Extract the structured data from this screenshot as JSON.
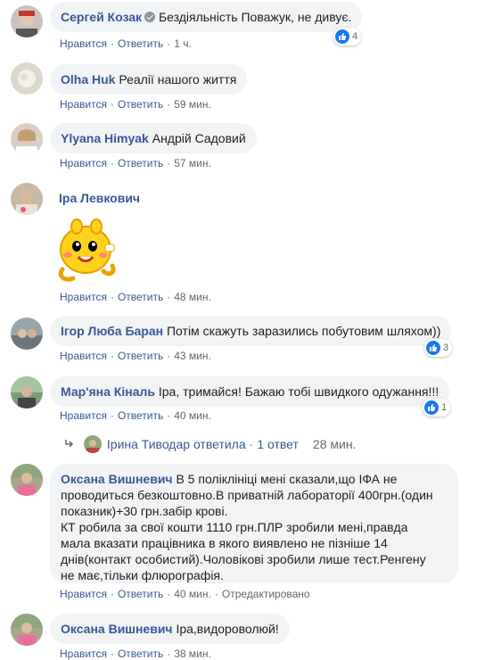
{
  "action_labels": {
    "like": "Нравится",
    "reply": "Ответить",
    "edited": "Отредактировано"
  },
  "comments": [
    {
      "author": "Сергей Козак",
      "text": "Бездіяльність Поважук, не дивує.",
      "time": "1 ч.",
      "reactions": "4"
    },
    {
      "author": "Olha Huk",
      "text": "Реалії нашого життя",
      "time": "59 мин."
    },
    {
      "author": "Ylyana Himyak",
      "text": "Андрій Садовий",
      "time": "57 мин."
    },
    {
      "author": "Іра Левкович",
      "text": "",
      "time": "48 мин."
    },
    {
      "author": "Ігор Люба Баран",
      "text": "Потім скажуть заразились побутовим шляхом))",
      "time": "43 мин.",
      "reactions": "3"
    },
    {
      "author": "Мар'яна Кіналь",
      "text": "Іра, тримайся! Бажаю тобі швидкого одужання!!!",
      "time": "40 мин.",
      "reactions": "1"
    },
    {
      "author": "Оксана Вишневич",
      "text_lines": [
        "В 5 поліклініці мені сказали,що ІФА не",
        "проводиться безкоштовно.В приватній лабораторії 400грн.(один",
        "показник)+30 грн.забір крові.",
        "КТ робила за свої кошти 1110 грн.ПЛР зробили мені,правда",
        "мала вказати працівника в якого виявлено не пізніше 14",
        "днів(контакт особистий).Чоловікові зробили лише тест.Ренгену",
        "не має,тільки флюрографія."
      ],
      "time": "40 мин."
    },
    {
      "author": "Оксана Вишневич",
      "text": "Іра,видороволюй!",
      "time": "38 мин."
    }
  ],
  "reply_thread": {
    "name": "Ірина Тиводар",
    "action": "ответила",
    "count": "1 ответ",
    "time": "28 мин."
  },
  "colors": {
    "link": "#385898",
    "bubble": "#f2f3f5",
    "meta": "#606770",
    "like": "#1877f2"
  }
}
